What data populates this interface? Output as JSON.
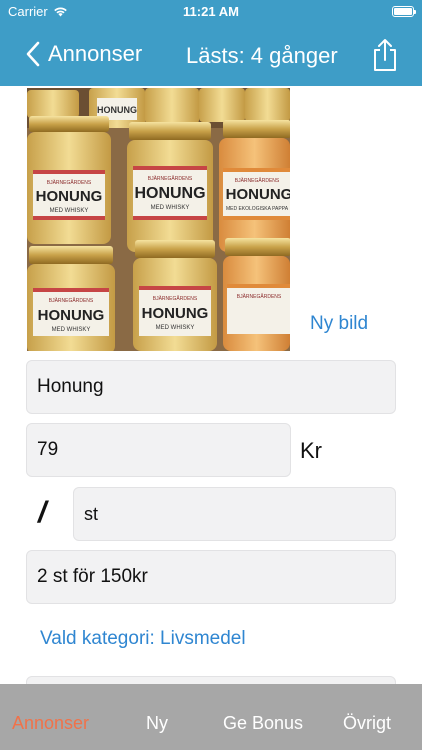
{
  "status_bar": {
    "carrier": "Carrier",
    "time": "11:21 AM"
  },
  "nav": {
    "back_label": "Annonser",
    "title": "Lästs: 4 gånger"
  },
  "photo": {
    "jar_brand": "BJÄRNEGÅRDENS",
    "jar_label": "HONUNG",
    "jar_sublabel": "MED WHISKY",
    "jar_sublabel_alt": "MED EKOLOGISKA PAPPA"
  },
  "form": {
    "new_image": "Ny bild",
    "name_value": "Honung",
    "price_value": "79",
    "currency": "Kr",
    "slash": "/",
    "unit_value": "st",
    "offer_value": "2 st för 150kr",
    "category": "Vald kategori: Livsmedel"
  },
  "tabs": [
    {
      "label": "Annonser",
      "active": true
    },
    {
      "label": "Ny"
    },
    {
      "label": "Ge Bonus"
    },
    {
      "label": "Övrigt"
    }
  ],
  "colors": {
    "header": "#3e9dc7",
    "link": "#2f86d1",
    "tab_active": "#f0724a",
    "tab_bar": "#a7a7a7"
  }
}
